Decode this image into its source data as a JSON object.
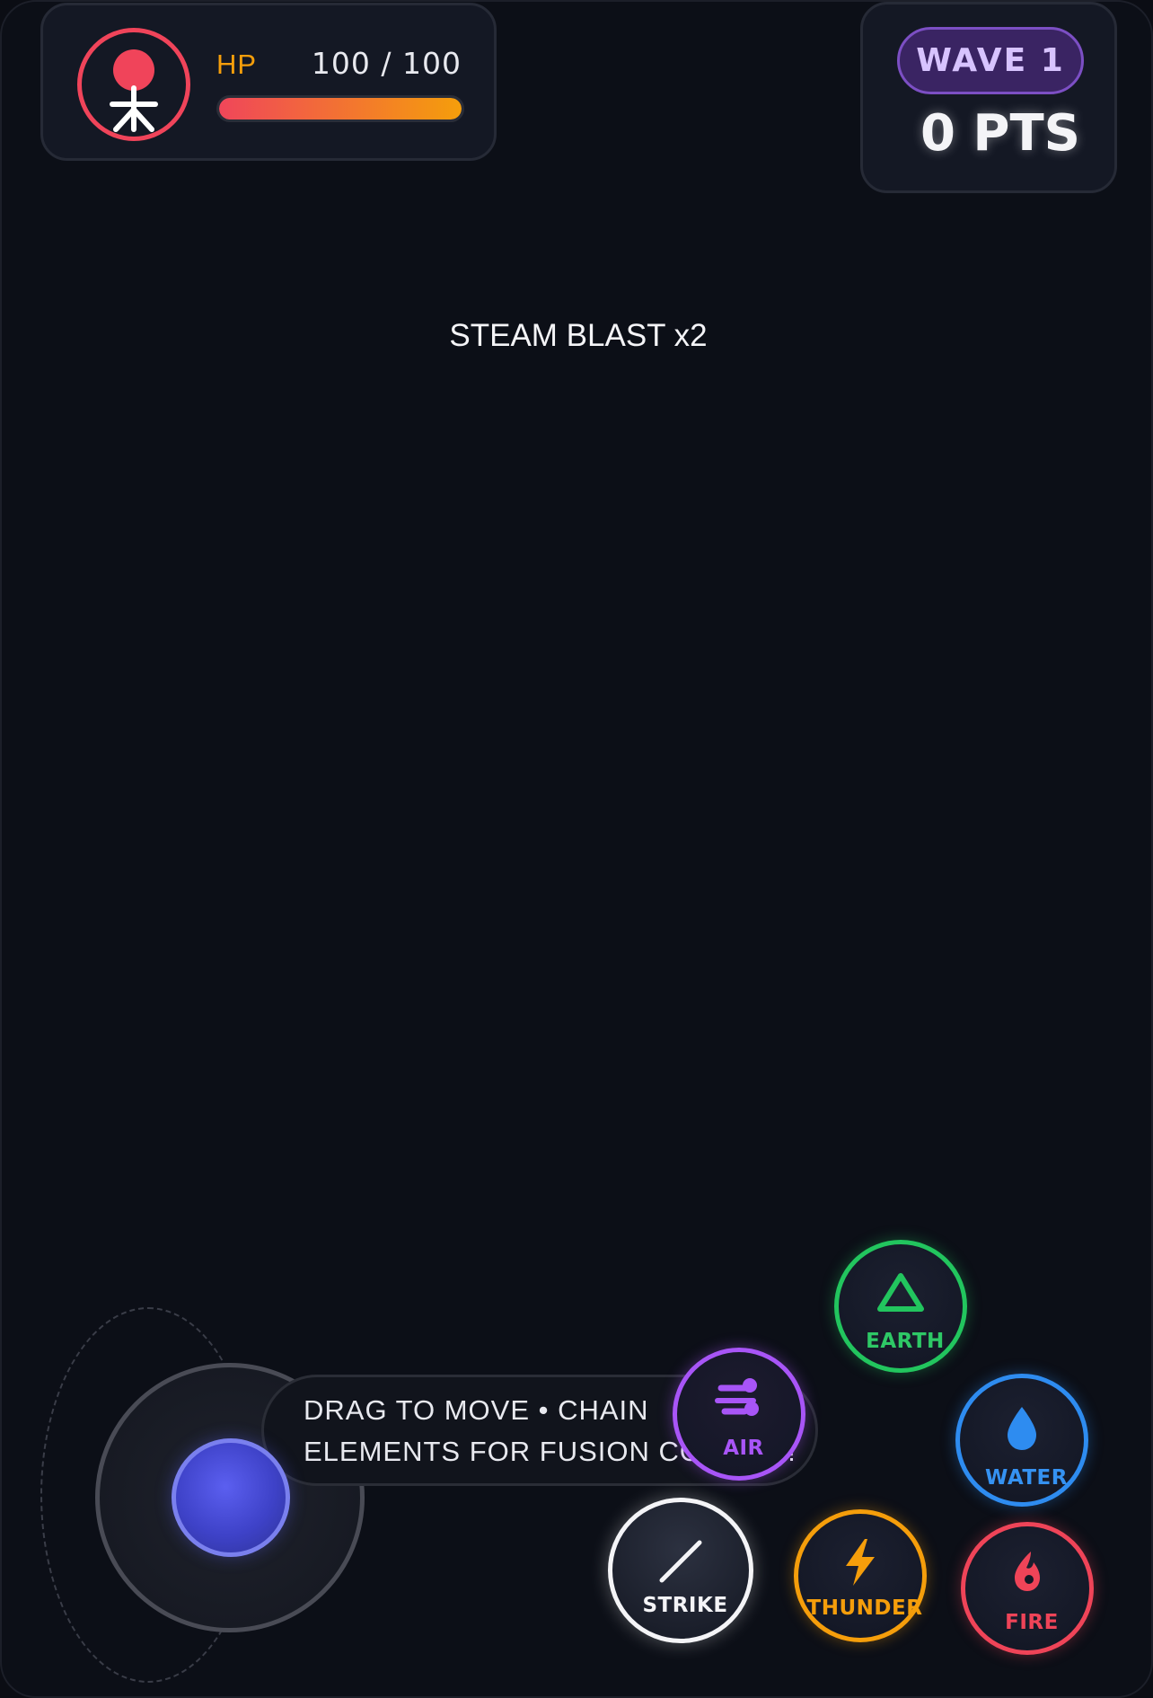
{
  "hud": {
    "hp_label": "HP",
    "hp_value": "100 / 100",
    "hp_current": 100,
    "hp_max": 100,
    "wave_label": "WAVE 1",
    "score_label": "0 PTS"
  },
  "combo_text": "STEAM BLAST x2",
  "hint": {
    "line1": "DRAG TO MOVE • CHAIN",
    "line2": "ELEMENTS FOR FUSION COMBOS!"
  },
  "abilities": {
    "earth": {
      "label": "EARTH",
      "icon": "triangle-icon",
      "color": "#22c55e"
    },
    "air": {
      "label": "AIR",
      "icon": "wind-icon",
      "color": "#a855f7"
    },
    "water": {
      "label": "WATER",
      "icon": "droplet-icon",
      "color": "#2e8cf0"
    },
    "strike": {
      "label": "STRIKE",
      "icon": "slash-icon",
      "color": "#f4f4f7"
    },
    "thunder": {
      "label": "THUNDER",
      "icon": "lightning-icon",
      "color": "#f59e0b"
    },
    "fire": {
      "label": "FIRE",
      "icon": "flame-icon",
      "color": "#ef4458"
    }
  },
  "colors": {
    "background": "#0c0f17",
    "panel": "#141824",
    "hp_gradient_start": "#f0465a",
    "hp_gradient_end": "#f59e0b",
    "wave_badge": "#3a2463",
    "joystick_knob": "#5b5ff0"
  }
}
